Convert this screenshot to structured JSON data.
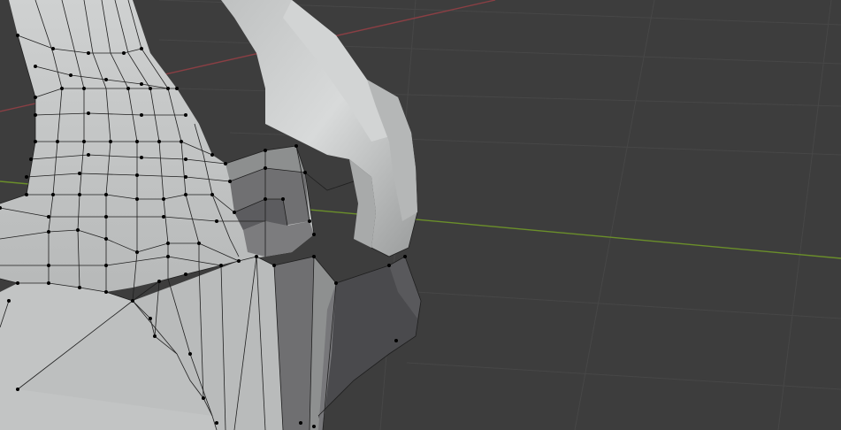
{
  "viewport": {
    "mode": "edit-mode",
    "shading": "solid",
    "colors": {
      "background": "#3d3d3d",
      "grid": "#4a4a4a",
      "x_axis": "#8a3f44",
      "y_axis": "#6b8f2a",
      "mesh_light": "#c8caca",
      "mesh_mid": "#a9abab",
      "mesh_dark": "#6d6d6f",
      "wire": "#1d1d1d",
      "vertex": "#000000"
    }
  }
}
